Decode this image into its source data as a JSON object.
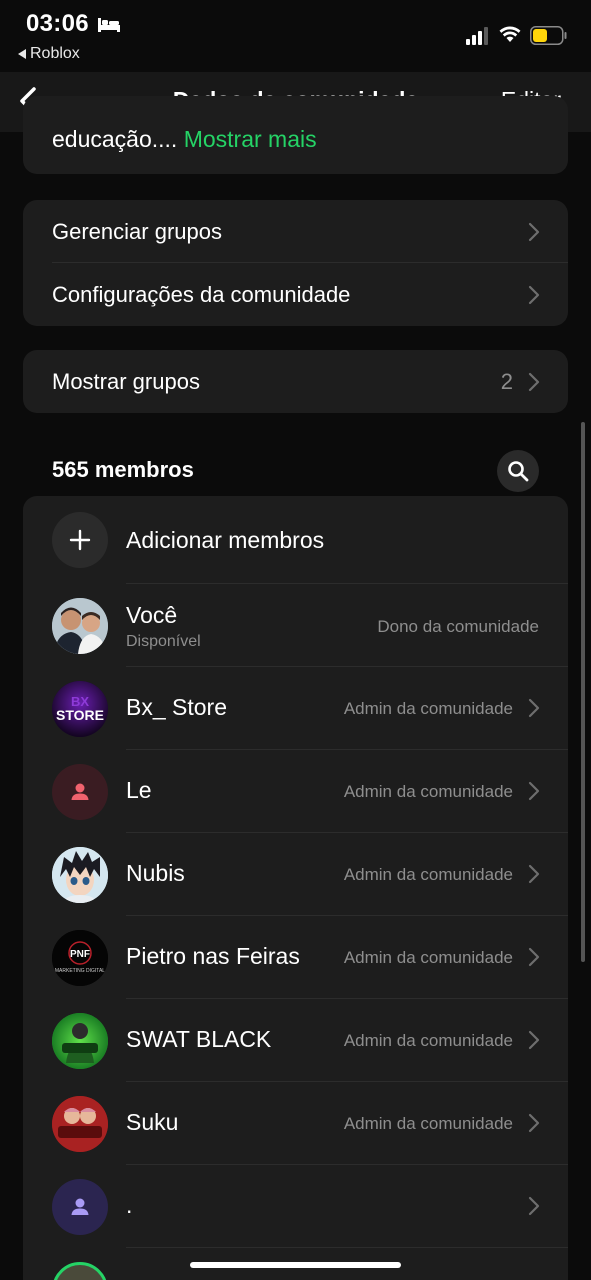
{
  "status_bar": {
    "time": "03:06",
    "back_app": "Roblox",
    "battery_color": "#ffd60a"
  },
  "nav": {
    "title": "Dados da comunidade",
    "edit_label": "Editar"
  },
  "description": {
    "text": "educação....",
    "more_label": "Mostrar mais",
    "accent": "#25d366"
  },
  "settings": [
    {
      "label": "Gerenciar grupos"
    },
    {
      "label": "Configurações da comunidade"
    }
  ],
  "groups": {
    "label": "Mostrar grupos",
    "count": "2"
  },
  "members": {
    "title": "565 membros",
    "add_label": "Adicionar membros",
    "list": [
      {
        "name": "Você",
        "subtitle": "Disponível",
        "role": "Dono da comunidade",
        "avatar": "photo-two-people"
      },
      {
        "name": "Bx_ Store",
        "role": "Admin da comunidade",
        "avatar": "logo-store"
      },
      {
        "name": "Le",
        "role": "Admin da comunidade",
        "avatar": "default-person-red"
      },
      {
        "name": "Nubis",
        "role": "Admin da comunidade",
        "avatar": "anime-character"
      },
      {
        "name": "Pietro nas Feiras",
        "role": "Admin da comunidade",
        "avatar": "logo-pnf",
        "logo_text": "PNF",
        "logo_sub": "MARKETING DIGITAL"
      },
      {
        "name": "SWAT BLACK",
        "role": "Admin da comunidade",
        "avatar": "logo-swat"
      },
      {
        "name": "Suku",
        "role": "Admin da comunidade",
        "avatar": "logo-sukuna"
      },
      {
        "name": ".",
        "role": "",
        "avatar": "default-person-purple"
      }
    ]
  }
}
